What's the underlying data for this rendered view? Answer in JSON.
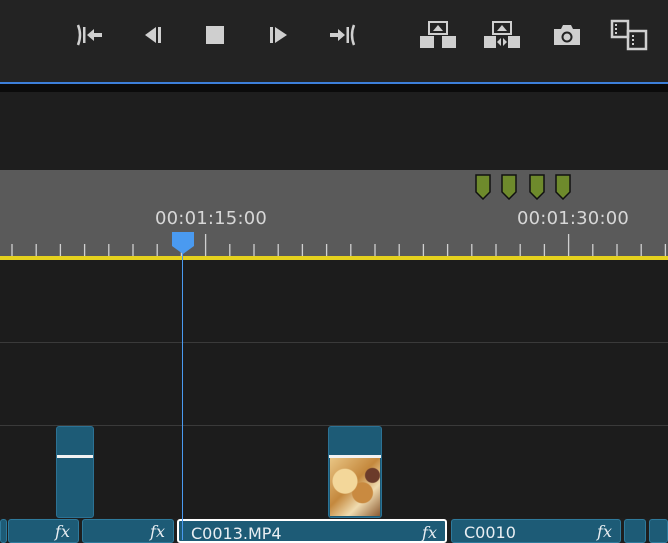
{
  "toolbar": {
    "buttons": [
      {
        "icon": "go-to-in-icon"
      },
      {
        "icon": "step-back-icon"
      },
      {
        "icon": "stop-icon"
      },
      {
        "icon": "step-forward-icon"
      },
      {
        "icon": "go-to-out-icon"
      },
      {
        "icon": "lift-icon"
      },
      {
        "icon": "extract-icon"
      },
      {
        "icon": "export-frame-icon"
      },
      {
        "icon": "comparison-view-icon"
      }
    ]
  },
  "ruler": {
    "timecodes": [
      "00:01:15:00",
      "00:01:30:00"
    ],
    "marker_color": "#6e8a2c"
  },
  "timeline": {
    "playhead_color": "#4a9af0",
    "work_area_color": "#e6d21e",
    "audio_clips": [
      {
        "name": "",
        "fx": "fx"
      },
      {
        "name": "",
        "fx": "fx"
      },
      {
        "name": "C0013.MP4",
        "fx": "fx"
      },
      {
        "name": "C0010",
        "fx": "fx"
      },
      {
        "name": "",
        "fx": ""
      },
      {
        "name": "",
        "fx": ""
      }
    ]
  }
}
